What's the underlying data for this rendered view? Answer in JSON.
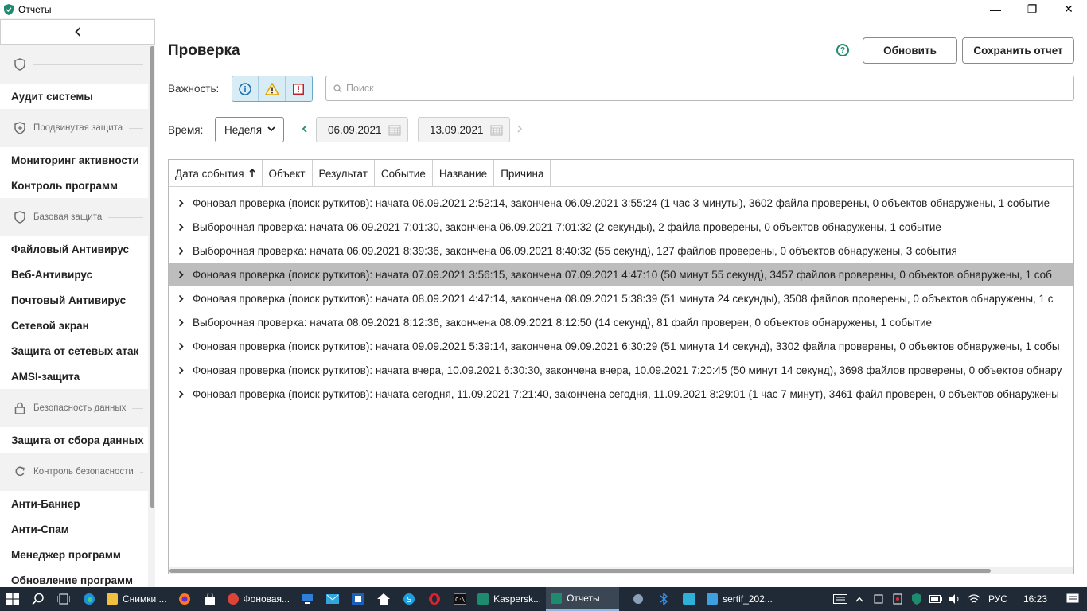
{
  "window": {
    "title": "Отчеты",
    "minimize": "—",
    "maximize": "❐",
    "close": "✕"
  },
  "sidebar": {
    "groups": [
      {
        "label": "",
        "icon": "shield-icon",
        "items": [
          "Аудит системы"
        ]
      },
      {
        "label": "Продвинутая защита",
        "icon": "shield-plus-icon",
        "items": [
          "Мониторинг активности",
          "Контроль программ"
        ]
      },
      {
        "label": "Базовая защита",
        "icon": "shield-icon",
        "items": [
          "Файловый Антивирус",
          "Веб-Антивирус",
          "Почтовый Антивирус",
          "Сетевой экран",
          "Защита от сетевых атак",
          "AMSI-защита"
        ]
      },
      {
        "label": "Безопасность данных",
        "icon": "lock-icon",
        "items": [
          "Защита от сбора данных"
        ]
      },
      {
        "label": "Контроль безопасности",
        "icon": "refresh-shield-icon",
        "items": [
          "Анти-Баннер",
          "Анти-Спам",
          "Менеджер программ",
          "Обновление программ"
        ]
      }
    ]
  },
  "main": {
    "title": "Проверка",
    "refresh_label": "Обновить",
    "save_label": "Сохранить отчет",
    "severity_label": "Важность:",
    "search_placeholder": "Поиск",
    "time_label": "Время:",
    "period_value": "Неделя",
    "date_from": "06.09.2021",
    "date_to": "13.09.2021"
  },
  "table": {
    "columns": [
      "Дата события",
      "Объект",
      "Результат",
      "Событие",
      "Название",
      "Причина"
    ],
    "sort_arrow": "🠕",
    "rows": [
      "Фоновая проверка (поиск руткитов): начата 06.09.2021 2:52:14, закончена 06.09.2021 3:55:24 (1 час 3 минуты), 3602 файла проверены, 0 объектов обнаружены, 1 событие",
      "Выборочная проверка: начата 06.09.2021 7:01:30, закончена 06.09.2021 7:01:32 (2 секунды), 2 файла проверены, 0 объектов обнаружены, 1 событие",
      "Выборочная проверка: начата 06.09.2021 8:39:36, закончена 06.09.2021 8:40:32 (55 секунд), 127 файлов проверены, 0 объектов обнаружены, 3 события",
      "Фоновая проверка (поиск руткитов): начата 07.09.2021 3:56:15, закончена 07.09.2021 4:47:10 (50 минут 55 секунд), 3457 файлов проверены, 0 объектов обнаружены, 1 соб",
      "Фоновая проверка (поиск руткитов): начата 08.09.2021 4:47:14, закончена 08.09.2021 5:38:39 (51 минута 24 секунды), 3508 файлов проверены, 0 объектов обнаружены, 1 с",
      "Выборочная проверка: начата 08.09.2021 8:12:36, закончена 08.09.2021 8:12:50 (14 секунд), 81 файл проверен, 0 объектов обнаружены, 1 событие",
      "Фоновая проверка (поиск руткитов): начата 09.09.2021 5:39:14, закончена 09.09.2021 6:30:29 (51 минута 14 секунд), 3302 файла проверены, 0 объектов обнаружены, 1 собы",
      "Фоновая проверка (поиск руткитов): начата вчера, 10.09.2021 6:30:30, закончена вчера, 10.09.2021 7:20:45 (50 минут 14 секунд), 3698 файлов проверены, 0 объектов обнару",
      "Фоновая проверка (поиск руткитов): начата сегодня, 11.09.2021 7:21:40, закончена сегодня, 11.09.2021 8:29:01 (1 час 7 минут), 3461 файл проверен, 0 объектов обнаружены"
    ],
    "selected_row": 3
  },
  "taskbar": {
    "apps": [
      "Снимки ...",
      "Фоновая...",
      "Kaspersk...",
      "Отчеты",
      "sertif_202..."
    ],
    "lang": "РУС",
    "time": "16:23"
  },
  "colors": {
    "accent": "#1e8a6e",
    "selected_row": "#bdbdbd",
    "taskbar": "#1f2a36"
  }
}
